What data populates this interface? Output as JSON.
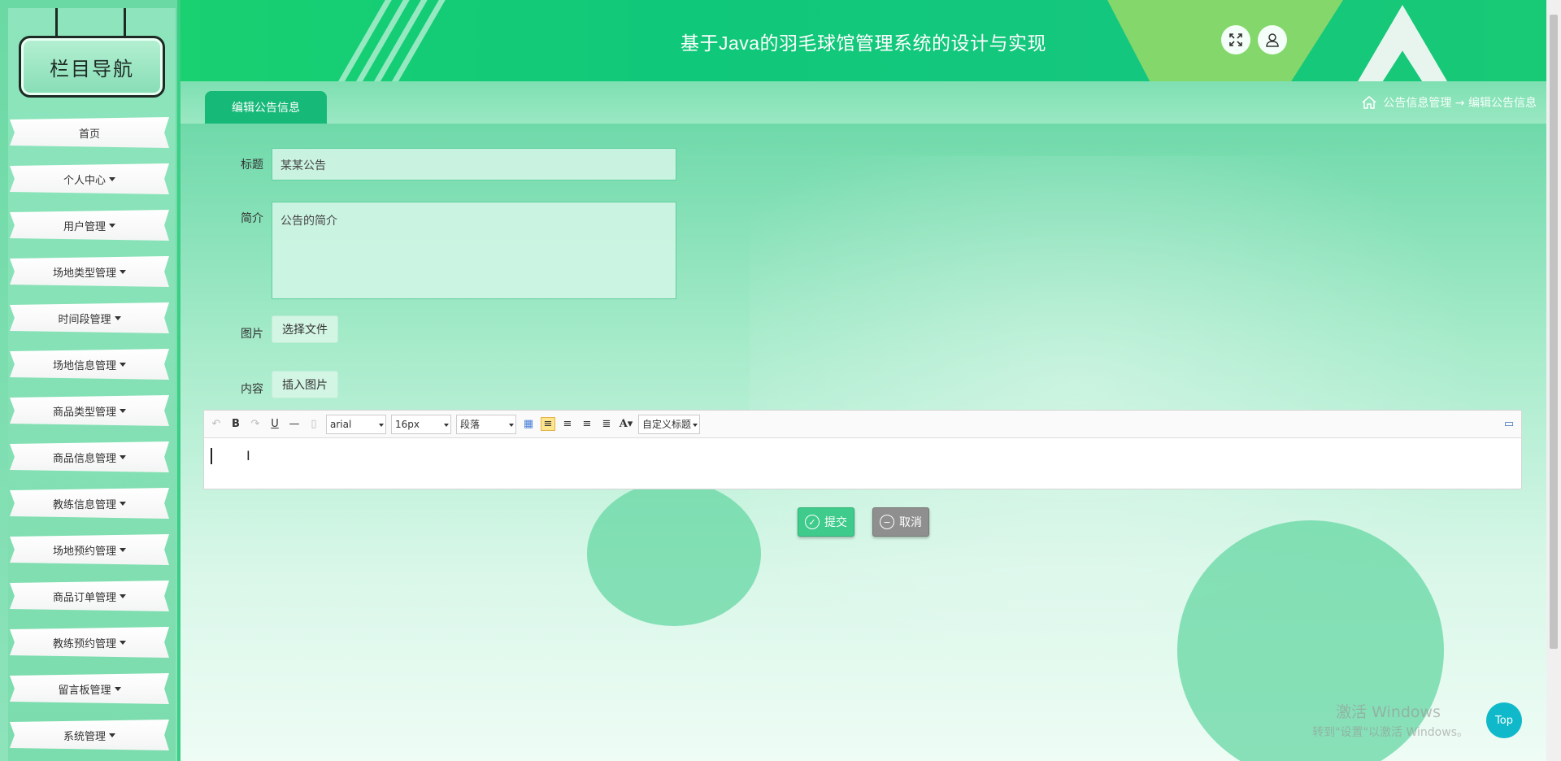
{
  "app_title": "基于Java的羽毛球馆管理系统的设计与实现",
  "sidebar": {
    "heading": "栏目导航",
    "items": [
      {
        "label": "首页",
        "has_caret": false
      },
      {
        "label": "个人中心",
        "has_caret": true
      },
      {
        "label": "用户管理",
        "has_caret": true
      },
      {
        "label": "场地类型管理",
        "has_caret": true
      },
      {
        "label": "时间段管理",
        "has_caret": true
      },
      {
        "label": "场地信息管理",
        "has_caret": true
      },
      {
        "label": "商品类型管理",
        "has_caret": true
      },
      {
        "label": "商品信息管理",
        "has_caret": true
      },
      {
        "label": "教练信息管理",
        "has_caret": true
      },
      {
        "label": "场地预约管理",
        "has_caret": true
      },
      {
        "label": "商品订单管理",
        "has_caret": true
      },
      {
        "label": "教练预约管理",
        "has_caret": true
      },
      {
        "label": "留言板管理",
        "has_caret": true
      },
      {
        "label": "系统管理",
        "has_caret": true
      }
    ]
  },
  "header": {
    "fullscreen_icon": "expand-icon",
    "user_icon": "user-icon"
  },
  "tab": {
    "label": "编辑公告信息"
  },
  "breadcrumb": {
    "home_icon": "home-icon",
    "text": "公告信息管理 → 编辑公告信息"
  },
  "form": {
    "title_label": "标题",
    "title_value": "某某公告",
    "summary_label": "简介",
    "summary_value": "公告的简介",
    "image_label": "图片",
    "image_button": "选择文件",
    "content_label": "内容",
    "content_button": "插入图片"
  },
  "editor": {
    "font_family": "arial",
    "font_size": "16px",
    "paragraph": "段落",
    "custom_title": "自定义标题"
  },
  "actions": {
    "submit": "提交",
    "cancel": "取消"
  },
  "watermark": {
    "line1": "激活 Windows",
    "line2": "转到\"设置\"以激活 Windows。"
  },
  "top_button": "Top",
  "colors": {
    "accent": "#17b978",
    "submit": "#3fcb8b",
    "cancel": "#8f8f8f",
    "top": "#10b9c9"
  }
}
